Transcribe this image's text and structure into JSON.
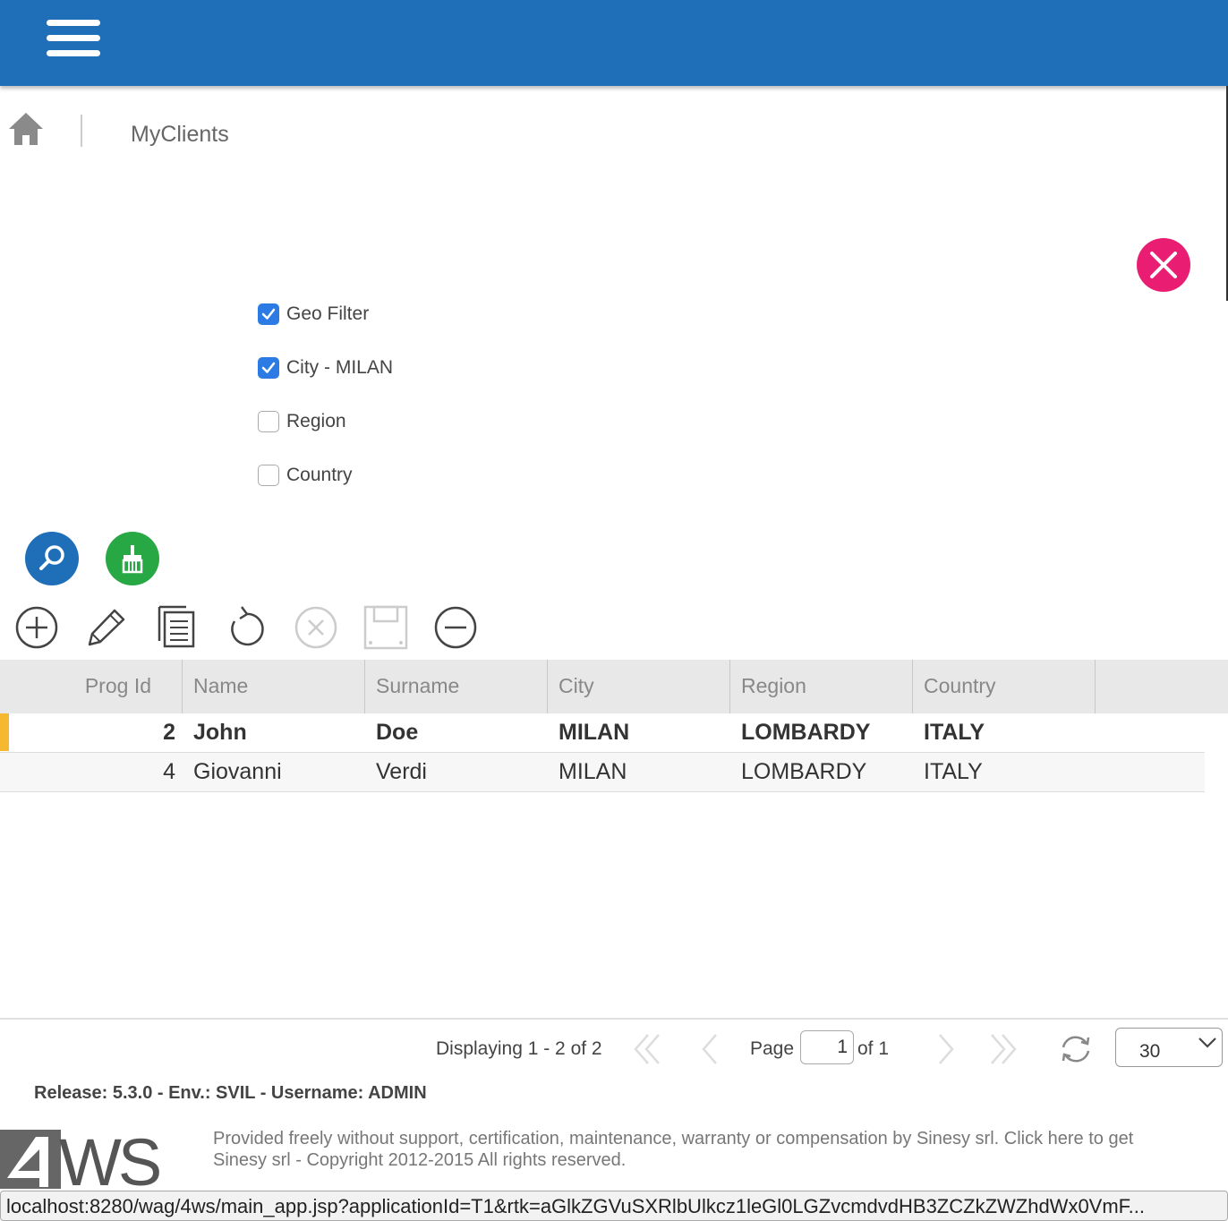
{
  "breadcrumb": {
    "title": "MyClients"
  },
  "filters": [
    {
      "label": "Geo Filter",
      "checked": true
    },
    {
      "label": "City - MILAN",
      "checked": true
    },
    {
      "label": "Region",
      "checked": false
    },
    {
      "label": "Country",
      "checked": false
    }
  ],
  "icons": {
    "menu": "hamburger-menu-icon",
    "home": "home-icon",
    "close": "close-icon",
    "search": "magnifier-icon",
    "clear": "broom-icon",
    "toolbar": [
      "add-icon",
      "edit-icon",
      "copy-icon",
      "refresh-icon",
      "cancel-icon",
      "save-icon",
      "remove-icon"
    ]
  },
  "colors": {
    "topbar": "#1e6eb8",
    "close": "#e91e72",
    "search": "#1e6eb8",
    "clear": "#27a844",
    "checkbox": "#2c7be5",
    "selected_marker": "#f5b82e"
  },
  "grid": {
    "columns": [
      "Prog Id",
      "Name",
      "Surname",
      "City",
      "Region",
      "Country"
    ],
    "rows": [
      {
        "prog_id": "2",
        "name": "John",
        "surname": "Doe",
        "city": "MILAN",
        "region": "LOMBARDY",
        "country": "ITALY"
      },
      {
        "prog_id": "4",
        "name": "Giovanni",
        "surname": "Verdi",
        "city": "MILAN",
        "region": "LOMBARDY",
        "country": "ITALY"
      }
    ]
  },
  "pager": {
    "displaying": "Displaying 1 - 2 of 2",
    "page_label": "Page",
    "page_value": "1",
    "of_label": "of 1",
    "page_size": "30"
  },
  "footer": {
    "release": "Release: 5.3.0 - Env.: SVIL - Username: ADMIN",
    "legal_line1": "Provided freely without support, certification, maintenance, warranty or compensation by Sinesy srl. Click here to get",
    "legal_line2": "Sinesy srl - Copyright 2012-2015 All rights reserved.",
    "logo_text": "4WS"
  },
  "status_url": "localhost:8280/wag/4ws/main_app.jsp?applicationId=T1&rtk=aGlkZGVuSXRlbUlkcz1leGl0LGZvcmdvdHB3ZCZkZWZhdWx0VmF..."
}
